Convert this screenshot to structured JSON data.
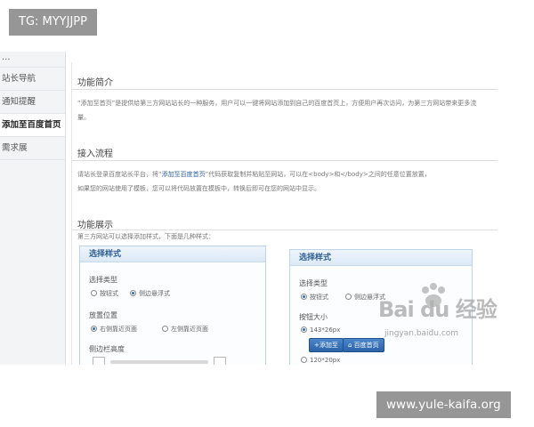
{
  "overlay": {
    "top_left_tag": "TG: MYYJJPP",
    "bottom_right_tag": "www.yule-kaifa.org"
  },
  "sidebar": {
    "items": [
      {
        "label": "…"
      },
      {
        "label": "站长导航"
      },
      {
        "label": "通知提醒"
      },
      {
        "label": "添加至百度首页"
      },
      {
        "label": "需求展"
      }
    ]
  },
  "main": {
    "intro_title": "功能简介",
    "intro_text_a": "“添加至首页”",
    "intro_text_b": "是提供给第三方网站站长的一种服务，用户可以一键将网站添加到自己的百度首页上，方便用户再次访问，为第三方网站带来更多流量。",
    "flow_title": "接入流程",
    "flow_text_a": "请站长登录百度站长平台，将“",
    "flow_link": "添加至百度首页",
    "flow_text_b": "”代码获取复制并粘贴至网站，可以在<body>和</body>之间的任意位置放置，",
    "flow_text_c": "如果您的网站使用了模板，您可以将代码放置在模板中，转换后即可在您的网站中显示。",
    "demo_title": "功能展示",
    "demo_text": "第三方网站可以选择添加样式，下面是几种样式："
  },
  "panel_left": {
    "title": "选择样式",
    "type_label": "选择类型",
    "type_opt1": "按钮式",
    "type_opt2": "侧边悬浮式",
    "position_label": "放置位置",
    "position_opt1": "右侧靠近页面",
    "position_opt2": "左侧靠近页面",
    "height_label": "侧边栏高度"
  },
  "panel_right": {
    "title": "选择样式",
    "type_label": "选择类型",
    "type_opt1": "按钮式",
    "type_opt2": "侧边悬浮式",
    "size_label": "按钮大小",
    "size_opt1": "143*26px",
    "size_opt2": "120*20px",
    "btn_add": "+添加至",
    "btn_home": "百度首页"
  },
  "watermark": {
    "logo": "Bai du 经验",
    "url": "jingyan.baidu.com"
  },
  "colors": {
    "accent": "#2b63a8",
    "panel_border": "#bcd3e8",
    "overlay": "#787878"
  }
}
